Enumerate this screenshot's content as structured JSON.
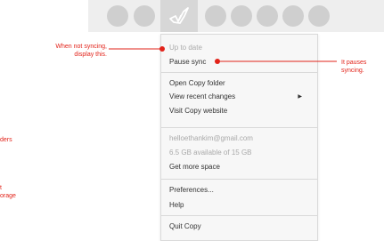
{
  "menubar": {
    "icons": [
      "status-circle",
      "status-circle",
      "copy-crane-icon",
      "status-circle",
      "status-circle",
      "status-circle",
      "status-circle",
      "status-circle"
    ]
  },
  "menu": {
    "status": "Up to date",
    "pause": "Pause sync",
    "open_folder": "Open Copy folder",
    "view_recent": "View recent changes",
    "visit_site": "Visit Copy website",
    "email": "helloethankim@gmail.com",
    "storage": "6.5 GB available of 15 GB",
    "more_space": "Get more space",
    "preferences": "Preferences...",
    "help": "Help",
    "quit": "Quit Copy"
  },
  "annotations": {
    "not_syncing_line1": "When not syncing,",
    "not_syncing_line2": "display this.",
    "pauses_line1": "It pauses",
    "pauses_line2": "syncing.",
    "left_partial_1": "ders",
    "left_partial_2a": "t",
    "left_partial_2b": "orage"
  },
  "colors": {
    "annotation_red": "#e2231a",
    "menubar_bg": "#eeeeee",
    "menu_bg": "#f7f7f7",
    "disabled_text": "#aaaaaa"
  }
}
